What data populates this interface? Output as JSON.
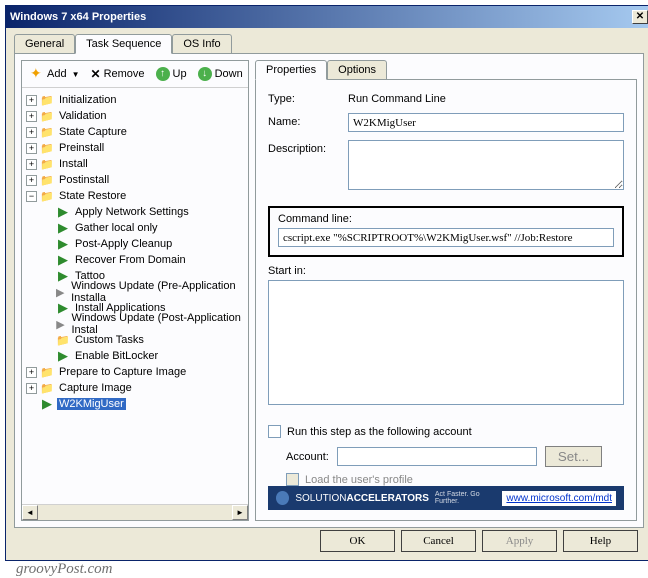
{
  "window": {
    "title": "Windows 7 x64 Properties"
  },
  "mainTabs": {
    "general": "General",
    "taskSequence": "Task Sequence",
    "osInfo": "OS Info"
  },
  "toolbar": {
    "add": "Add",
    "remove": "Remove",
    "up": "Up",
    "down": "Down"
  },
  "tree": {
    "initialization": "Initialization",
    "validation": "Validation",
    "stateCapture": "State Capture",
    "preinstall": "Preinstall",
    "install": "Install",
    "postinstall": "Postinstall",
    "stateRestore": "State Restore",
    "applyNetwork": "Apply Network Settings",
    "gatherLocal": "Gather local only",
    "postApply": "Post-Apply Cleanup",
    "recoverDomain": "Recover From Domain",
    "tattoo": "Tattoo",
    "winUpdatePre": "Windows Update (Pre-Application Installa",
    "installApps": "Install Applications",
    "winUpdatePost": "Windows Update (Post-Application Instal",
    "customTasks": "Custom Tasks",
    "enableBitlocker": "Enable BitLocker",
    "prepareCapture": "Prepare to Capture Image",
    "captureImage": "Capture Image",
    "w2kMigUser": "W2KMigUser"
  },
  "rightTabs": {
    "properties": "Properties",
    "options": "Options"
  },
  "fields": {
    "typeLabel": "Type:",
    "typeValue": "Run Command Line",
    "nameLabel": "Name:",
    "nameValue": "W2KMigUser",
    "descLabel": "Description:",
    "cmdLabel": "Command line:",
    "cmdValue": "cscript.exe \"%SCRIPTROOT%\\W2KMigUser.wsf\" //Job:Restore",
    "startInLabel": "Start in:",
    "runAsLabel": "Run this step as the following account",
    "accountLabel": "Account:",
    "setBtn": "Set...",
    "loadProfile": "Load the user's profile"
  },
  "banner": {
    "brand1": "SOLUTION",
    "brand2": "ACCELERATORS",
    "sub": "Act Faster. Go Further.",
    "link": "www.microsoft.com/mdt"
  },
  "buttons": {
    "ok": "OK",
    "cancel": "Cancel",
    "apply": "Apply",
    "help": "Help"
  },
  "watermark": "groovyPost.com"
}
